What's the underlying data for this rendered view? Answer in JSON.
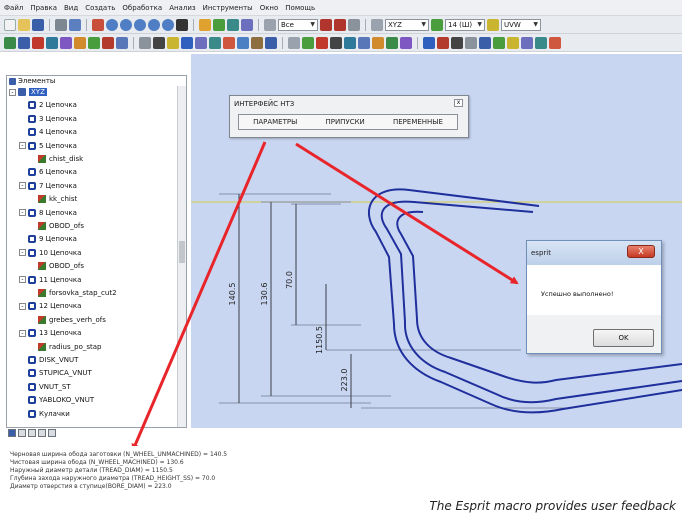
{
  "menubar": {
    "items": [
      "Файл",
      "Правка",
      "Вид",
      "Создать",
      "Обработка",
      "Анализ",
      "Инструменты",
      "Окно",
      "Помощь"
    ]
  },
  "toolbar": {
    "combo_all": "Все",
    "combo_xyz": "XYZ",
    "combo_number": "14 (Ш)",
    "combo_view": "UVW"
  },
  "tree": {
    "header": "Элементы",
    "items": [
      {
        "label": "XYZ",
        "level": 0,
        "kind": "root",
        "expander": "-",
        "selected": true
      },
      {
        "label": "2 Цепочка",
        "level": 1,
        "kind": "chain",
        "expander": ""
      },
      {
        "label": "3 Цепочка",
        "level": 1,
        "kind": "chain",
        "expander": ""
      },
      {
        "label": "4 Цепочка",
        "level": 1,
        "kind": "chain",
        "expander": ""
      },
      {
        "label": "5 Цепочка",
        "level": 1,
        "kind": "chain",
        "expander": "-"
      },
      {
        "label": "chist_disk",
        "level": 2,
        "kind": "feature",
        "expander": ""
      },
      {
        "label": "6 Цепочка",
        "level": 1,
        "kind": "chain",
        "expander": ""
      },
      {
        "label": "7 Цепочка",
        "level": 1,
        "kind": "chain",
        "expander": "-"
      },
      {
        "label": "kk_chist",
        "level": 2,
        "kind": "feature",
        "expander": ""
      },
      {
        "label": "8 Цепочка",
        "level": 1,
        "kind": "chain",
        "expander": "-"
      },
      {
        "label": "OBOD_ofs",
        "level": 2,
        "kind": "feature",
        "expander": ""
      },
      {
        "label": "9 Цепочка",
        "level": 1,
        "kind": "chain",
        "expander": ""
      },
      {
        "label": "10 Цепочка",
        "level": 1,
        "kind": "chain",
        "expander": "-"
      },
      {
        "label": "OBOD_ofs",
        "level": 2,
        "kind": "feature",
        "expander": ""
      },
      {
        "label": "11 Цепочка",
        "level": 1,
        "kind": "chain",
        "expander": "-"
      },
      {
        "label": "forsovka_stap_cut2",
        "level": 2,
        "kind": "feature",
        "expander": ""
      },
      {
        "label": "12 Цепочка",
        "level": 1,
        "kind": "chain",
        "expander": "-"
      },
      {
        "label": "grebes_verh_ofs",
        "level": 2,
        "kind": "feature",
        "expander": ""
      },
      {
        "label": "13 Цепочка",
        "level": 1,
        "kind": "chain",
        "expander": "-"
      },
      {
        "label": "radius_po_stap",
        "level": 2,
        "kind": "feature",
        "expander": ""
      },
      {
        "label": "DISK_VNUT",
        "level": 1,
        "kind": "chain",
        "expander": ""
      },
      {
        "label": "STUPICA_VNUT",
        "level": 1,
        "kind": "chain",
        "expander": ""
      },
      {
        "label": "VNUT_ST",
        "level": 1,
        "kind": "chain",
        "expander": ""
      },
      {
        "label": "YABLOKO_VNUT",
        "level": 1,
        "kind": "chain",
        "expander": ""
      },
      {
        "label": "Кулачки",
        "level": 1,
        "kind": "chain",
        "expander": ""
      }
    ]
  },
  "interface_window": {
    "title": "ИНТЕРФЕЙС НТЗ",
    "close_label": "x",
    "tabs": [
      "ПАРАМЕТРЫ",
      "ПРИПУСКИ",
      "ПЕРЕМЕННЫЕ"
    ]
  },
  "message_box": {
    "title": "esprit",
    "close_label": "X",
    "text": "Успешно выполнено!",
    "ok_label": "OK"
  },
  "dimensions": {
    "dim_140_5": "140.5",
    "dim_130_6": "130.6",
    "dim_70_0": "70.0",
    "dim_1150_5": "1150.5",
    "dim_223_0": "223.0"
  },
  "output_lines": [
    "Черновая ширина обода заготовки (N_WHEEL_UNMACHINED) = 140.5",
    "Чистовая ширина обода (N_WHEEL_MACHINED) = 130.6",
    "Наружный диаметр детали (TREAD_DIAM) = 1150.5",
    "Глубина захода наружного диаметра (TREAD_HEIGHT_SS) = 70.0",
    "Диаметр отверстия в ступице(BORE_DIAM) = 223.0"
  ],
  "caption": "The Esprit macro provides user feedback",
  "colors": {
    "canvas_bg": "#c9d6f2",
    "profile_line": "#1f2f9c",
    "arrow_red": "#e8252a",
    "axis_yellow": "#d6cf4a"
  }
}
